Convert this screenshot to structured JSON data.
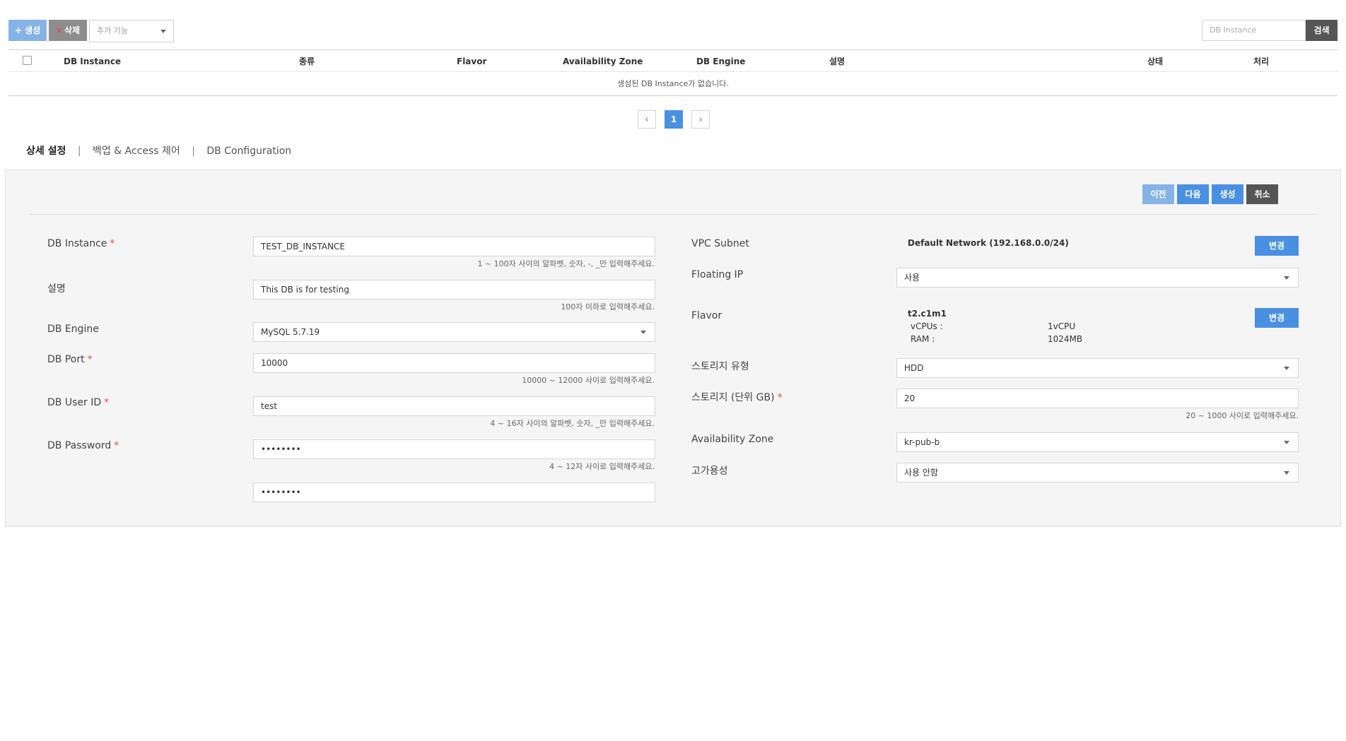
{
  "toolbar": {
    "create_label": "+ 생성",
    "delete_x": "×",
    "delete_label": "삭제",
    "extra_select_value": "추가 기능",
    "search_placeholder": "DB Instance",
    "search_label": "검색"
  },
  "table": {
    "headers": [
      "DB Instance",
      "종류",
      "Flavor",
      "Availability Zone",
      "DB Engine",
      "설명",
      "상태",
      "처리"
    ],
    "empty_message": "생성된 DB Instance가 없습니다."
  },
  "pagination": {
    "prev_icon": "‹",
    "current_page": "1",
    "next_icon": "›"
  },
  "tabs": {
    "items": [
      "상세 설정",
      "백업 & Access 제어",
      "DB Configuration"
    ],
    "separator": "|"
  },
  "panel": {
    "actions": {
      "prev_label": "이전",
      "next_label": "다음",
      "create_label": "생성",
      "cancel_label": "취소"
    },
    "left": {
      "db_instance_label": "DB Instance",
      "db_instance_value": "TEST_DB_INSTANCE",
      "db_instance_hint": "1 ~ 100자 사이의 알파벳, 숫자, -, _만 입력해주세요.",
      "desc_label": "설명",
      "desc_value": "This DB is for testing",
      "desc_hint": "100자 이하로 입력해주세요.",
      "engine_label": "DB Engine",
      "engine_value": "MySQL 5.7.19",
      "port_label": "DB Port",
      "port_value": "10000",
      "port_hint": "10000 ~ 12000 사이로 입력해주세요.",
      "user_label": "DB User ID",
      "user_value": "test",
      "user_hint": "4 ~ 16자 사이의 알파벳, 숫자, _만 입력해주세요.",
      "password_label": "DB Password",
      "password_value": "••••••••",
      "password_hint": "4 ~ 12자 사이로 입력해주세요.",
      "password_confirm_value": "••••••••",
      "required_mark": "*"
    },
    "right": {
      "vpc_label": "VPC Subnet",
      "vpc_value": "Default Network (192.168.0.0/24)",
      "change_label": "변경",
      "floating_label": "Floating IP",
      "floating_value": "사용",
      "flavor_label": "Flavor",
      "flavor_name": "t2.c1m1",
      "vcpus_label": "vCPUs :",
      "vcpus_value": "1vCPU",
      "ram_label": "RAM :",
      "ram_value": "1024MB",
      "storage_type_label": "스토리지 유형",
      "storage_type_value": "HDD",
      "storage_size_label": "스토리지 (단위 GB)",
      "storage_size_value": "20",
      "storage_size_hint": "20 ~ 1000 사이로 입력해주세요.",
      "az_label": "Availability Zone",
      "az_value": "kr-pub-b",
      "ha_label": "고가용성",
      "ha_value": "사용 안함"
    }
  }
}
